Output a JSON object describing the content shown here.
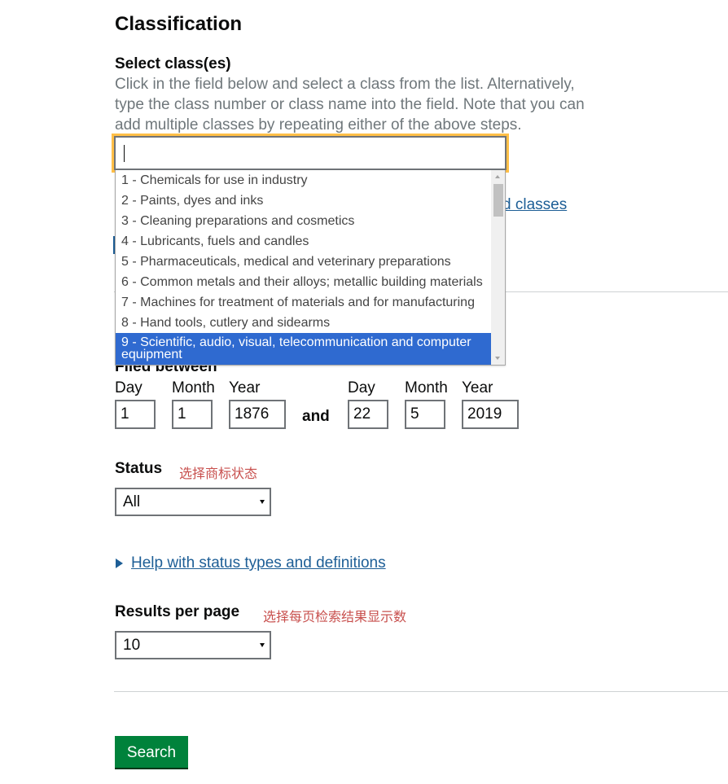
{
  "classification": {
    "title": "Classification",
    "select_label": "Select class(es)",
    "hint": "Click in the field below and select a class from the list. Alternatively, type the class number or class name into the field. Note that you can add multiple classes by repeating either of the above steps.",
    "input_value": "",
    "partial_link_text": "d classes",
    "options": [
      {
        "label": "1 - Chemicals for use in industry"
      },
      {
        "label": "2 - Paints, dyes and inks"
      },
      {
        "label": "3 - Cleaning preparations and cosmetics"
      },
      {
        "label": "4 - Lubricants, fuels and candles"
      },
      {
        "label": "5 - Pharmaceuticals, medical and veterinary preparations"
      },
      {
        "label": "6 - Common metals and their alloys; metallic building materials"
      },
      {
        "label": "7 - Machines for treatment of materials and for manufacturing"
      },
      {
        "label": "8 - Hand tools, cutlery and sidearms"
      },
      {
        "label": "9 - Scientific, audio, visual, telecommunication and computer equipment",
        "highlighted": true
      }
    ]
  },
  "filed_between": {
    "label": "Filed between",
    "and_label": "and",
    "from": {
      "day_label": "Day",
      "month_label": "Month",
      "year_label": "Year",
      "day": "1",
      "month": "1",
      "year": "1876"
    },
    "to": {
      "day_label": "Day",
      "month_label": "Month",
      "year_label": "Year",
      "day": "22",
      "month": "5",
      "year": "2019"
    }
  },
  "status": {
    "label": "Status",
    "annotation": "选择商标状态",
    "selected": "All",
    "help_link": "Help with status types and definitions"
  },
  "results_per_page": {
    "label": "Results per page",
    "annotation": "选择每页检索结果显示数",
    "selected": "10"
  },
  "search_button": "Search",
  "colors": {
    "link": "#1d5e96",
    "focus": "#ffbf47",
    "highlight": "#2f6ad0",
    "button": "#00823b",
    "annotation": "#c8504e"
  }
}
